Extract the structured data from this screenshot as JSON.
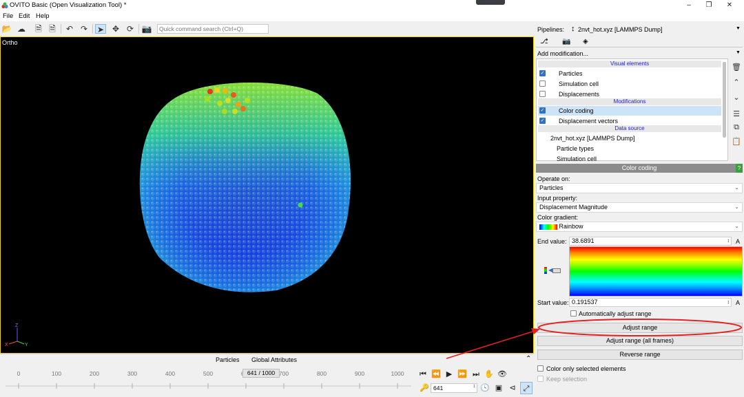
{
  "window": {
    "title": "OVITO Basic (Open Visualization Tool) *"
  },
  "menu": [
    "File",
    "Edit",
    "Help"
  ],
  "toolbar": {
    "search_placeholder": "Quick command search (Ctrl+Q)"
  },
  "viewport": {
    "caption": "Ortho",
    "axis_labels": [
      "Z",
      "X",
      "Y"
    ]
  },
  "bottom_tabs": [
    "Particles",
    "Global Attributes"
  ],
  "timeline": {
    "ticks": [
      "0",
      "100",
      "200",
      "300",
      "400",
      "500",
      "600",
      "700",
      "800",
      "900",
      "1000"
    ],
    "frame_display": "641 / 1000",
    "current_frame": "641"
  },
  "pipelines": {
    "label": "Pipelines:",
    "selected": "2nvt_hot.xyz [LAMMPS Dump]",
    "add_modification": "Add modification...",
    "sections": {
      "visual": "Visual elements",
      "modifications": "Modifications",
      "data_source": "Data source"
    },
    "visual_items": [
      {
        "label": "Particles",
        "checked": true
      },
      {
        "label": "Simulation cell",
        "checked": false
      },
      {
        "label": "Displacements",
        "checked": false
      }
    ],
    "modification_items": [
      {
        "label": "Color coding",
        "checked": true,
        "selected": true
      },
      {
        "label": "Displacement vectors",
        "checked": true,
        "selected": false
      }
    ],
    "source_items": [
      "2nvt_hot.xyz [LAMMPS Dump]",
      "Particle types",
      "Simulation cell"
    ]
  },
  "color_coding": {
    "header": "Color coding",
    "help": "?",
    "operate_on_label": "Operate on:",
    "operate_on": "Particles",
    "input_property_label": "Input property:",
    "input_property": "Displacement Magnitude",
    "gradient_label": "Color gradient:",
    "gradient": "Rainbow",
    "end_value_label": "End value:",
    "end_value": "38.6891",
    "start_value_label": "Start value:",
    "start_value": "0.191537",
    "unit_glyph": "A",
    "auto_adjust_label": "Automatically adjust range",
    "auto_adjust": false,
    "adjust_range": "Adjust range",
    "adjust_range_all": "Adjust range (all frames)",
    "reverse_range": "Reverse range",
    "color_only_selected": "Color only selected elements",
    "keep_selection": "Keep selection"
  },
  "colors": {
    "annotation_red": "#e32222",
    "viewport_border": "#f2d200",
    "selection_blue": "#cde3f7"
  }
}
